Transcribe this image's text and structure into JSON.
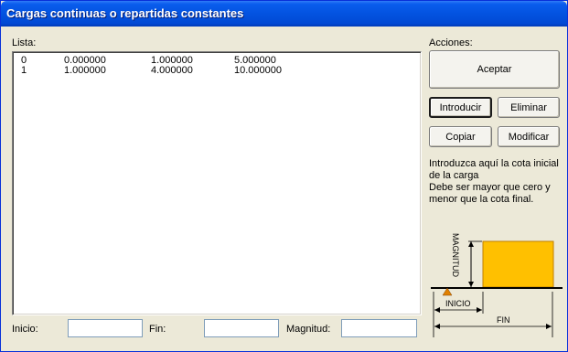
{
  "window": {
    "title": "Cargas continuas o repartidas constantes"
  },
  "list": {
    "label": "Lista:",
    "rows": [
      [
        "0",
        "0.000000",
        "1.000000",
        "5.000000"
      ],
      [
        "1",
        "1.000000",
        "4.000000",
        "10.000000"
      ]
    ]
  },
  "actions": {
    "label": "Acciones:",
    "accept": "Aceptar",
    "insert": "Introducir",
    "delete": "Eliminar",
    "copy": "Copiar",
    "modify": "Modificar"
  },
  "help": {
    "lines": [
      "Introduzca aquí la cota inicial",
      "de la carga",
      "Debe ser mayor que cero y",
      "menor que la cota final."
    ]
  },
  "diagram": {
    "magnitude_label": "MAGNITUD",
    "start_label": "INICIO",
    "end_label": "FIN",
    "load_color": "#ffc000",
    "support_color": "#e08000"
  },
  "fields": {
    "start": {
      "label": "Inicio:",
      "value": ""
    },
    "end": {
      "label": "Fin:",
      "value": ""
    },
    "magnitude": {
      "label": "Magnitud:",
      "value": ""
    }
  }
}
